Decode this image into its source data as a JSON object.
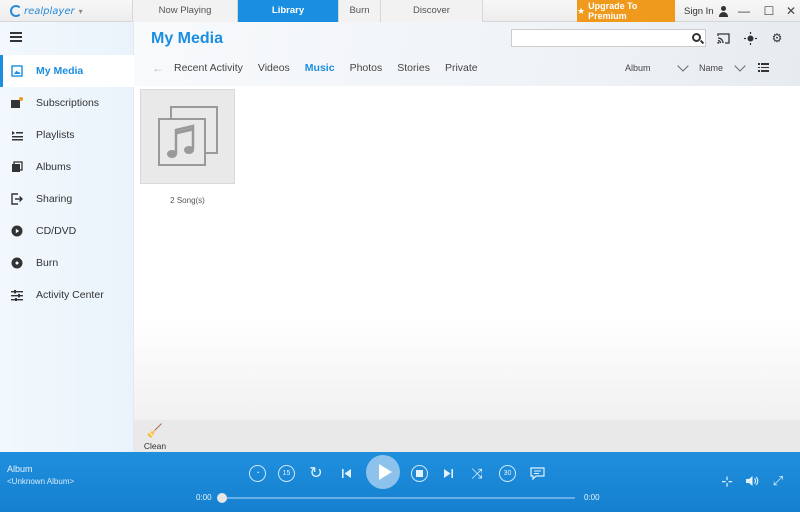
{
  "app": {
    "logo_text": "realplayer"
  },
  "tabs": [
    {
      "label": "Now Playing"
    },
    {
      "label": "Library"
    },
    {
      "label": "Burn"
    },
    {
      "label": "Discover"
    }
  ],
  "header_right": {
    "upgrade_label": "Upgrade To Premium",
    "signin_label": "Sign In"
  },
  "sidebar": {
    "items": [
      {
        "label": "My Media"
      },
      {
        "label": "Subscriptions"
      },
      {
        "label": "Playlists"
      },
      {
        "label": "Albums"
      },
      {
        "label": "Sharing"
      },
      {
        "label": "CD/DVD"
      },
      {
        "label": "Burn"
      },
      {
        "label": "Activity Center"
      }
    ]
  },
  "main": {
    "title": "My Media",
    "search": {
      "value": "",
      "placeholder": ""
    },
    "subnav": [
      "Recent Activity",
      "Videos",
      "Music",
      "Photos",
      "Stories",
      "Private"
    ],
    "sort_group": "Album",
    "sort_order": "Name",
    "album": {
      "caption": "2 Song(s)"
    },
    "clean_label": "Clean"
  },
  "player": {
    "album_label": "Album",
    "album_value": "<Unknown Album>",
    "time_current": "0:00",
    "time_total": "0:00",
    "progress": 0,
    "skip_back_label": "15",
    "skip_fwd_label": "30"
  },
  "colors": {
    "accent": "#1a8ee0",
    "upgrade": "#ef9a1d",
    "player_bar": "#1f8fdd"
  }
}
